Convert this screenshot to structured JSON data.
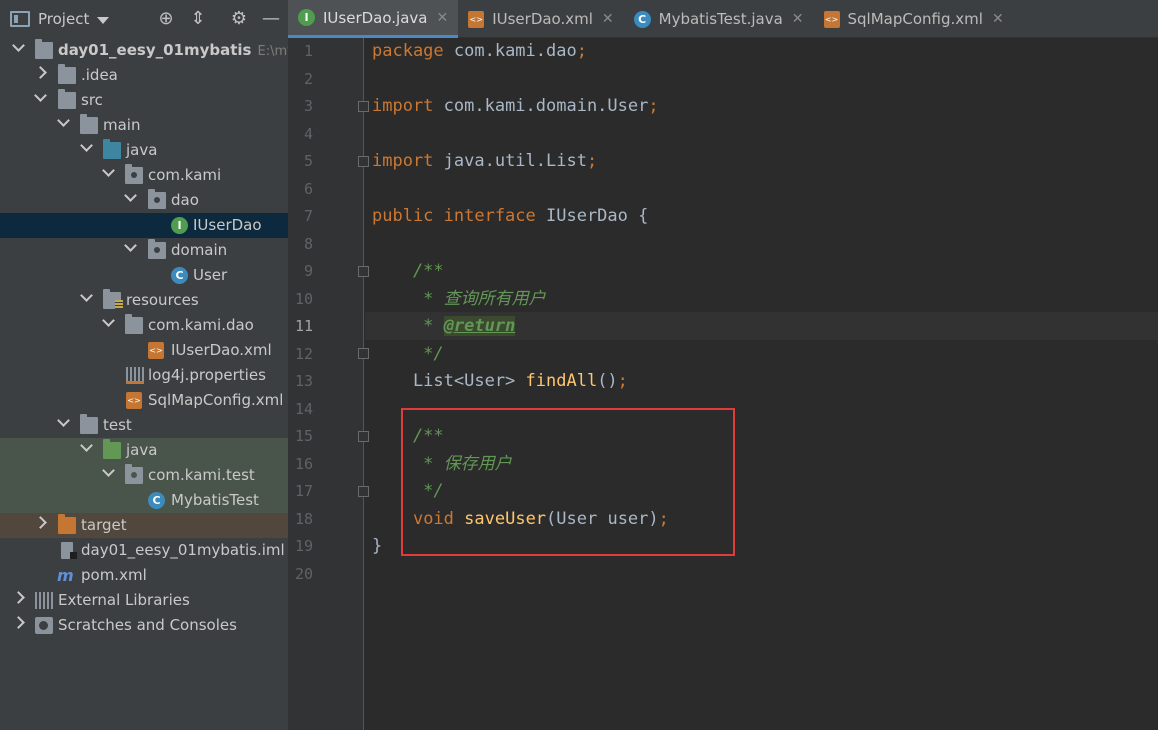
{
  "project_panel": {
    "title": "Project",
    "tree": [
      {
        "label": "day01_eesy_01mybatis",
        "hint": "E:\\myW",
        "type": "module"
      },
      {
        "label": ".idea",
        "type": "folder"
      },
      {
        "label": "src",
        "type": "folder"
      },
      {
        "label": "main",
        "type": "folder"
      },
      {
        "label": "java",
        "type": "source-folder"
      },
      {
        "label": "com.kami",
        "type": "package"
      },
      {
        "label": "dao",
        "type": "package"
      },
      {
        "label": "IUserDao",
        "type": "interface"
      },
      {
        "label": "domain",
        "type": "package"
      },
      {
        "label": "User",
        "type": "class"
      },
      {
        "label": "resources",
        "type": "resources-folder"
      },
      {
        "label": "com.kami.dao",
        "type": "package"
      },
      {
        "label": "IUserDao.xml",
        "type": "xml"
      },
      {
        "label": "log4j.properties",
        "type": "properties"
      },
      {
        "label": "SqlMapConfig.xml",
        "type": "xml"
      },
      {
        "label": "test",
        "type": "folder"
      },
      {
        "label": "java",
        "type": "test-folder"
      },
      {
        "label": "com.kami.test",
        "type": "package"
      },
      {
        "label": "MybatisTest",
        "type": "class"
      },
      {
        "label": "target",
        "type": "excluded-folder"
      },
      {
        "label": "day01_eesy_01mybatis.iml",
        "type": "iml"
      },
      {
        "label": "pom.xml",
        "type": "maven"
      },
      {
        "label": "External Libraries",
        "type": "libraries"
      },
      {
        "label": "Scratches and Consoles",
        "type": "scratches"
      }
    ]
  },
  "tabs": [
    {
      "label": "IUserDao.java",
      "icon": "interface-icon",
      "active": true
    },
    {
      "label": "IUserDao.xml",
      "icon": "xml-file-icon",
      "active": false
    },
    {
      "label": "MybatisTest.java",
      "icon": "class-icon",
      "active": false
    },
    {
      "label": "SqlMapConfig.xml",
      "icon": "xml-file-icon",
      "active": false
    }
  ],
  "editor": {
    "current_line": 11,
    "line_numbers": [
      "1",
      "2",
      "3",
      "4",
      "5",
      "6",
      "7",
      "8",
      "9",
      "10",
      "11",
      "12",
      "13",
      "14",
      "15",
      "16",
      "17",
      "18",
      "19",
      "20"
    ],
    "code": {
      "l1_kw": "package",
      "l1_rest": " com.kami.dao",
      "l1_semi": ";",
      "l3_kw": "import",
      "l3_rest": " com.kami.domain.User",
      "l3_semi": ";",
      "l5_kw": "import",
      "l5_rest": " java.util.List",
      "l5_semi": ";",
      "l7_kw": "public interface",
      "l7_rest": " IUserDao {",
      "l9": "    /**",
      "l10": "     * 查询所有用户",
      "l11_pre": "     * ",
      "l11_ann": "@return",
      "l12": "     */",
      "l13_pre": "    List<User> ",
      "l13_fn": "findAll",
      "l13_post": "()",
      "l13_semi": ";",
      "l15": "    /**",
      "l16": "     * 保存用户",
      "l17": "     */",
      "l18_pre": "    ",
      "l18_kw": "void",
      "l18_sp": " ",
      "l18_fn": "saveUser",
      "l18_post": "(User user)",
      "l18_semi": ";",
      "l19": "}"
    }
  },
  "colors": {
    "keyword": "#cc7832",
    "comment": "#629755",
    "method": "#ffc66d",
    "text": "#a9b7c6",
    "highlight_box": "#e03c3c",
    "selection": "#0d293e"
  }
}
